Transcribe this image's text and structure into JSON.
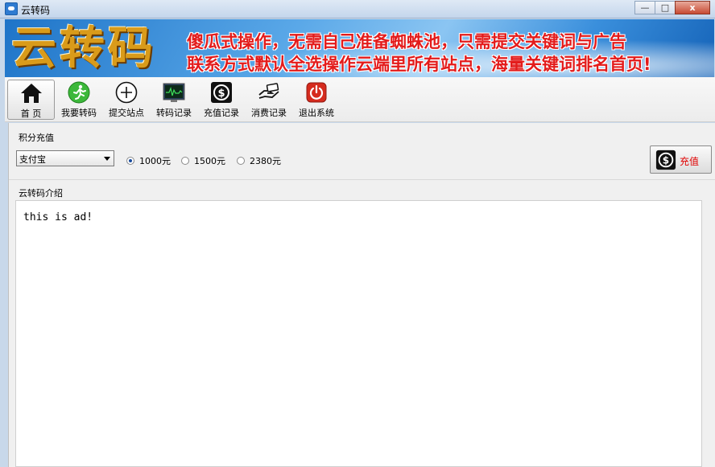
{
  "window": {
    "title": "云转码",
    "icon": "cloud-app-icon",
    "buttons": {
      "minimize": "—",
      "maximize": "□",
      "close": "x"
    }
  },
  "banner": {
    "logo_text": "云转码",
    "line1": "傻瓜式操作，无需自己准备蜘蛛池，只需提交关键词与广告",
    "line2": "联系方式默认全选操作云端里所有站点，海量关键词排名首页!"
  },
  "toolbar": {
    "items": [
      {
        "label": "首 页",
        "icon": "home-icon"
      },
      {
        "label": "我要转码",
        "icon": "running-man-icon"
      },
      {
        "label": "提交站点",
        "icon": "plus-circle-icon"
      },
      {
        "label": "转码记录",
        "icon": "monitor-chart-icon"
      },
      {
        "label": "充值记录",
        "icon": "dollar-icon"
      },
      {
        "label": "消费记录",
        "icon": "hand-card-icon"
      },
      {
        "label": "退出系统",
        "icon": "power-icon"
      }
    ]
  },
  "recharge": {
    "group_title": "积分充值",
    "payment_method": "支付宝",
    "options": [
      {
        "label": "1000元",
        "selected": true
      },
      {
        "label": "1500元",
        "selected": false
      },
      {
        "label": "2380元",
        "selected": false
      }
    ],
    "button_label": "充值"
  },
  "intro": {
    "group_title": "云转码介绍",
    "content": "this is ad!"
  },
  "colors": {
    "banner_text": "#e31b1b",
    "logo_gold": "#d99b1a",
    "recharge_text": "#e00000"
  }
}
